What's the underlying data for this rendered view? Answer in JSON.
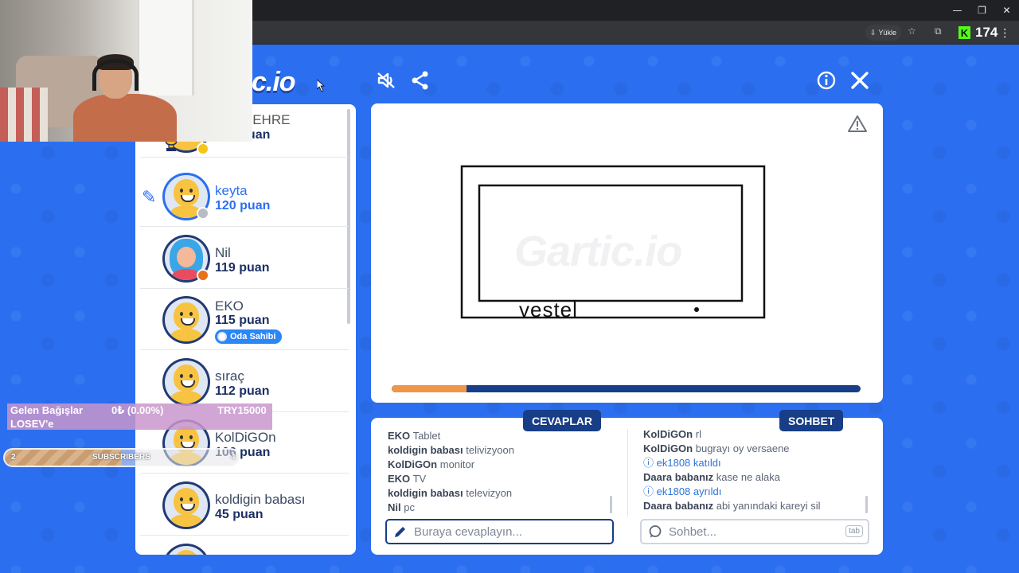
{
  "browser": {
    "yukle_label": "Yükle",
    "kick_count": "174"
  },
  "game": {
    "logo_text": "c.io",
    "players": [
      {
        "name": "MCI BEHRE",
        "points": "130 puan",
        "status_color": "#f5c518",
        "trophy": "1"
      },
      {
        "name": "keyta",
        "points": "120 puan",
        "status_color": "#b8bcc4",
        "drawing": true
      },
      {
        "name": "Nil",
        "points": "119 puan",
        "status_color": "#e8711c"
      },
      {
        "name": "EKO",
        "points": "115 puan",
        "host_badge": "Oda Sahibi"
      },
      {
        "name": "sıraç",
        "points": "112 puan"
      },
      {
        "name": "KolDiGOn",
        "points": "106 puan"
      },
      {
        "name": "koldigin babası",
        "points": "45 puan"
      }
    ],
    "canvas": {
      "drawn_word": "vestel",
      "timer_progress": 0.16
    },
    "answers": {
      "tab_label": "CEVAPLAR",
      "messages": [
        {
          "user": "EKO",
          "text": "Tablet"
        },
        {
          "user": "koldigin babası",
          "text": "telivizyoon"
        },
        {
          "user": "KolDiGOn",
          "text": "monitor"
        },
        {
          "user": "EKO",
          "text": "TV"
        },
        {
          "user": "koldigin babası",
          "text": "televizyon"
        },
        {
          "user": "Nil",
          "text": "pc"
        }
      ],
      "placeholder": "Buraya cevaplayın..."
    },
    "chat": {
      "tab_label": "SOHBET",
      "messages": [
        {
          "user": "KolDiGOn",
          "text": "rl",
          "type": "normal"
        },
        {
          "user": "KolDiGOn",
          "text": "bugrayı oy versaene",
          "type": "normal"
        },
        {
          "user": "ek1808",
          "text": "katıldı",
          "type": "system"
        },
        {
          "user": "Daara babanız",
          "text": "kase ne alaka",
          "type": "normal"
        },
        {
          "user": "ek1808",
          "text": "ayrıldı",
          "type": "system"
        },
        {
          "user": "Daara babanız",
          "text": "abi yanındaki kareyi sil",
          "type": "normal"
        }
      ],
      "placeholder": "Sohbet...",
      "tab_key": "tab"
    }
  },
  "overlay": {
    "donation_title": "Gelen Bağışlar",
    "donation_amount": "0₺ (0.00%)",
    "donation_goal": "TRY15000",
    "donation_target": "LOSEV'e",
    "subs_label": "SUBSCRIBERS",
    "subs_current": "2",
    "subs_goal": "4",
    "subs_progress": 0.5
  },
  "colors": {
    "brand_blue": "#2b6ff0",
    "navy": "#173e86",
    "timer_orange": "#f0964a",
    "kick_green": "#53fc18"
  }
}
